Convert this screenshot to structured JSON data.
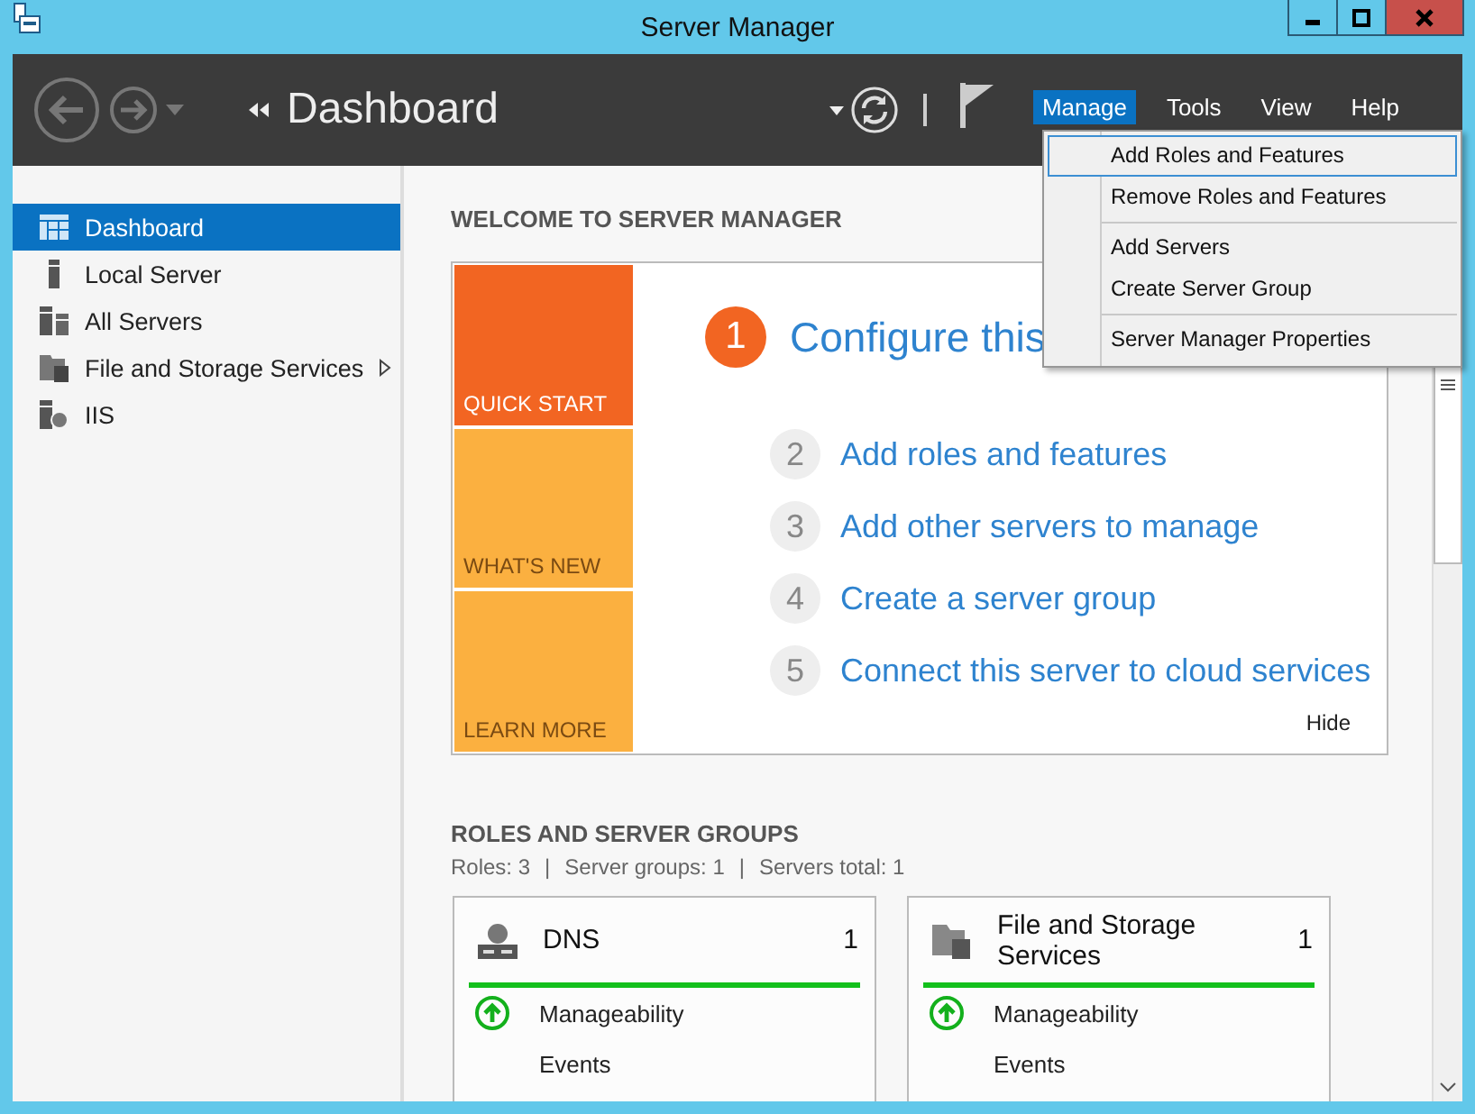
{
  "window": {
    "title": "Server Manager"
  },
  "header": {
    "breadcrumb": "Dashboard",
    "menu": [
      {
        "label": "Manage",
        "selected": true
      },
      {
        "label": "Tools",
        "selected": false
      },
      {
        "label": "View",
        "selected": false
      },
      {
        "label": "Help",
        "selected": false
      }
    ]
  },
  "manage_menu": {
    "groups": [
      {
        "items": [
          {
            "label": "Add Roles and Features",
            "selected": true
          },
          {
            "label": "Remove Roles and Features",
            "selected": false
          }
        ]
      },
      {
        "items": [
          {
            "label": "Add Servers",
            "selected": false
          },
          {
            "label": "Create Server Group",
            "selected": false
          }
        ]
      },
      {
        "items": [
          {
            "label": "Server Manager Properties",
            "selected": false
          }
        ]
      }
    ]
  },
  "sidebar": {
    "items": [
      {
        "label": "Dashboard",
        "kind": "dashboard",
        "selected": true,
        "expandable": false
      },
      {
        "label": "Local Server",
        "kind": "server",
        "selected": false,
        "expandable": false
      },
      {
        "label": "All Servers",
        "kind": "servers",
        "selected": false,
        "expandable": false
      },
      {
        "label": "File and Storage Services",
        "kind": "storage",
        "selected": false,
        "expandable": true
      },
      {
        "label": "IIS",
        "kind": "web",
        "selected": false,
        "expandable": false
      }
    ]
  },
  "welcome": {
    "heading": "WELCOME TO SERVER MANAGER",
    "tiles": [
      {
        "label": "QUICK START",
        "selected": true
      },
      {
        "label": "WHAT'S NEW",
        "selected": false
      },
      {
        "label": "LEARN MORE",
        "selected": false
      }
    ],
    "steps": [
      {
        "number": "1",
        "text": "Configure this",
        "selected": true
      },
      {
        "number": "2",
        "text": "Add roles and features",
        "selected": false
      },
      {
        "number": "3",
        "text": "Add other servers to manage",
        "selected": false
      },
      {
        "number": "4",
        "text": "Create a server group",
        "selected": false
      },
      {
        "number": "5",
        "text": "Connect this server to cloud services",
        "selected": false
      }
    ],
    "hide": "Hide"
  },
  "roles": {
    "heading": "ROLES AND SERVER GROUPS",
    "summary": [
      "Roles: 3",
      "Server groups: 1",
      "Servers total: 1"
    ],
    "summary_separator": "|",
    "tiles": [
      {
        "name": "DNS",
        "count": "1",
        "kind": "dns",
        "healthy": true,
        "rows": [
          {
            "label": "Manageability",
            "ok": true
          },
          {
            "label": "Events",
            "ok": false
          }
        ]
      },
      {
        "name": "File and Storage Services",
        "count": "1",
        "kind": "storage",
        "healthy": true,
        "rows": [
          {
            "label": "Manageability",
            "ok": true
          },
          {
            "label": "Events",
            "ok": false
          }
        ]
      }
    ]
  }
}
